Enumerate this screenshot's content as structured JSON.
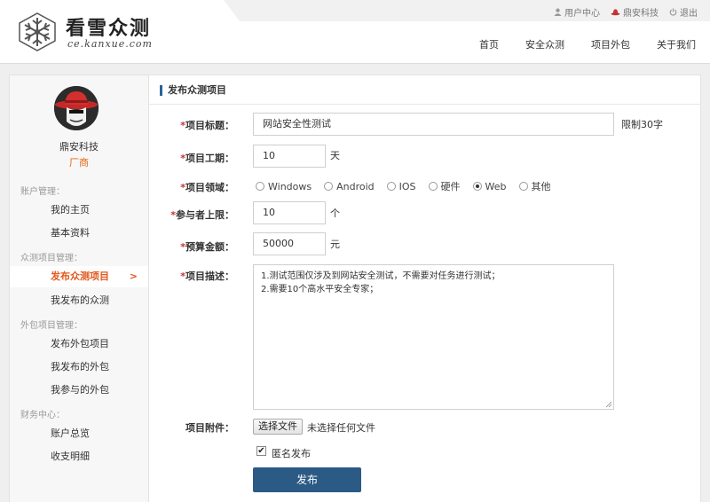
{
  "header": {
    "logo_name": "看雪众测",
    "logo_url": "ce.kanxue.com",
    "top_links": [
      {
        "icon": "user-icon",
        "label": "用户中心"
      },
      {
        "icon": "hat-icon",
        "label": "鼎安科技"
      },
      {
        "icon": "power-icon",
        "label": "退出"
      }
    ],
    "nav": [
      "首页",
      "安全众测",
      "项目外包",
      "关于我们"
    ]
  },
  "sidebar": {
    "user_name": "鼎安科技",
    "user_role": "厂商",
    "sections": [
      {
        "title": "账户管理：",
        "items": [
          "我的主页",
          "基本资料"
        ]
      },
      {
        "title": "众测项目管理：",
        "items": [
          "发布众测项目",
          "我发布的众测"
        ]
      },
      {
        "title": "外包项目管理：",
        "items": [
          "发布外包项目",
          "我发布的外包",
          "我参与的外包"
        ]
      },
      {
        "title": "财务中心：",
        "items": [
          "账户总览",
          "收支明细"
        ]
      }
    ],
    "active_arrow": ">"
  },
  "form": {
    "page_title": "发布众测项目",
    "title_label": "项目标题：",
    "title_value": "网站安全性测试",
    "title_hint": "限制30字",
    "period_label": "项目工期：",
    "period_value": "10",
    "period_unit": "天",
    "domain_label": "项目领域：",
    "domain_options": [
      "Windows",
      "Android",
      "IOS",
      "硬件",
      "Web",
      "其他"
    ],
    "domain_selected": "Web",
    "limit_label": "参与者上限：",
    "limit_value": "10",
    "limit_unit": "个",
    "budget_label": "预算金额：",
    "budget_value": "50000",
    "budget_unit": "元",
    "desc_label": "项目描述：",
    "desc_lines": [
      "1.测试范围仅涉及到网站安全测试，不需要对任务进行测试；",
      "2.需要10个高水平安全专家；"
    ],
    "attach_label": "项目附件：",
    "attach_button": "选择文件",
    "attach_status": "未选择任何文件",
    "anonymous_label": "匿名发布",
    "anonymous_checked": true,
    "submit_label": "发布",
    "required_mark": "*"
  },
  "colors": {
    "accent": "#2b5a85",
    "active": "#e2571e",
    "required": "#c9302c",
    "role": "#e06a13"
  }
}
